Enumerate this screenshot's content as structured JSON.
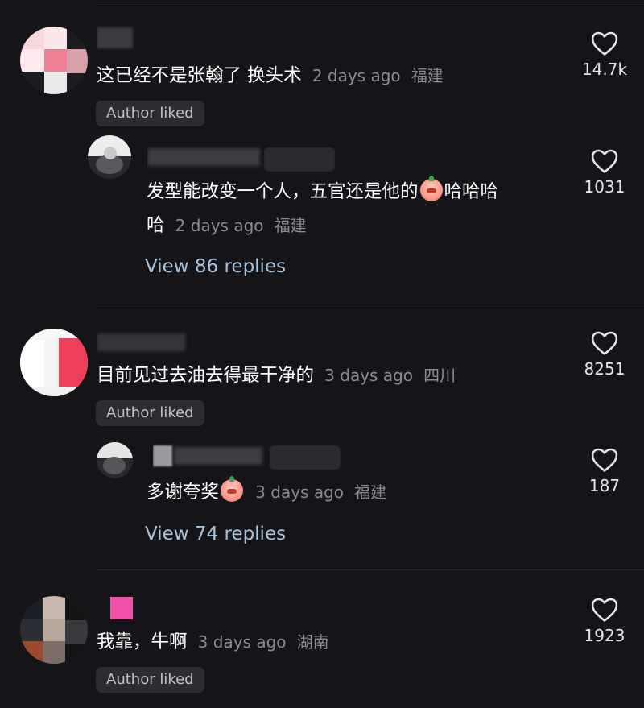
{
  "theme": {
    "background": "#151519",
    "text_primary": "#ffffff",
    "text_meta": "#8b8b91",
    "link_color": "#a9c3dd",
    "badge_bg": "#2c2c31",
    "divider": "#2b2b31"
  },
  "comments": [
    {
      "text": "这已经不是张翰了 换头术",
      "time": "2 days ago",
      "location": "福建",
      "likes": "14.7k",
      "badge": "Author liked",
      "reply": {
        "text_line1": "发型能改变一个人，五官还是他的",
        "emoji": "blush-emoji",
        "text_line1_tail": "哈哈哈",
        "text_line2": "哈",
        "time": "2 days ago",
        "location": "福建",
        "likes": "1031"
      },
      "view_replies": "View 86 replies"
    },
    {
      "text": "目前见过去油去得最干净的",
      "time": "3 days ago",
      "location": "四川",
      "likes": "8251",
      "badge": "Author liked",
      "reply": {
        "text_line1": "多谢夸奖",
        "emoji": "blush-emoji",
        "time": "3 days ago",
        "location": "福建",
        "likes": "187"
      },
      "view_replies": "View 74 replies"
    },
    {
      "text": "我靠，牛啊",
      "time": "3 days ago",
      "location": "湖南",
      "likes": "1923",
      "badge": "Author liked"
    }
  ],
  "icons": {
    "like": "heart-outline-icon"
  }
}
